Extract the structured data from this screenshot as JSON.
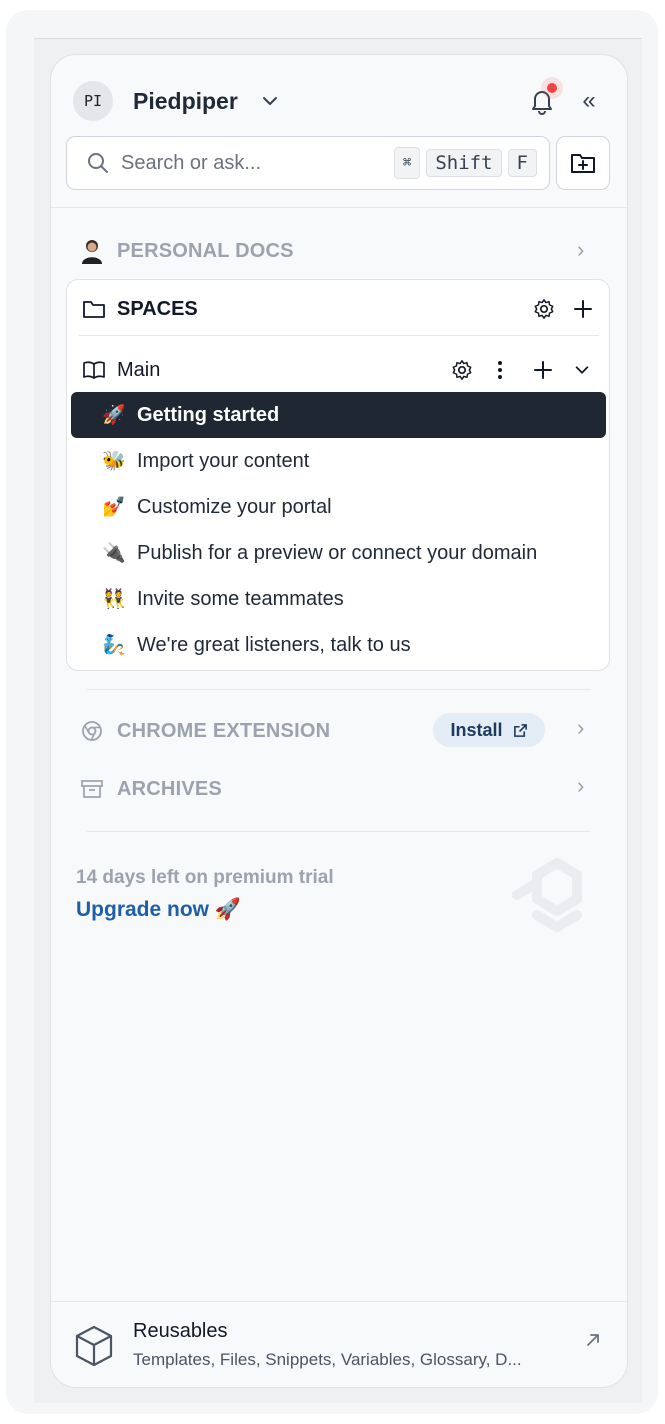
{
  "header": {
    "avatar_initials": "PI",
    "org_name": "Piedpiper",
    "collapse_glyph": "«"
  },
  "search": {
    "placeholder": "Search or ask...",
    "shortcut": [
      "⌘",
      "Shift",
      "F"
    ]
  },
  "sections": {
    "personal_docs": "PERSONAL DOCS",
    "spaces": "SPACES",
    "chrome_extension": "CHROME EXTENSION",
    "archives": "ARCHIVES"
  },
  "space": {
    "name": "Main",
    "items": [
      {
        "emoji": "🚀",
        "label": "Getting started",
        "active": true
      },
      {
        "emoji": "🐝",
        "label": "Import your content"
      },
      {
        "emoji": "💅",
        "label": "Customize your portal"
      },
      {
        "emoji": "🔌",
        "label": "Publish for a preview or connect your domain"
      },
      {
        "emoji": "👯",
        "label": "Invite some teammates"
      },
      {
        "emoji": "🧞",
        "label": "We're great listeners, talk to us"
      }
    ]
  },
  "chrome_extension": {
    "install_label": "Install"
  },
  "trial": {
    "days_left_text": "14 days left on premium trial",
    "upgrade_label": "Upgrade now 🚀"
  },
  "footer": {
    "title": "Reusables",
    "subtitle": "Templates, Files, Snippets, Variables, Glossary, D..."
  },
  "colors": {
    "active_item_bg": "#1f2733",
    "upgrade_link": "#1f5fa8",
    "notification_dot": "#ef4444",
    "install_pill_bg": "#e4ecf5"
  }
}
